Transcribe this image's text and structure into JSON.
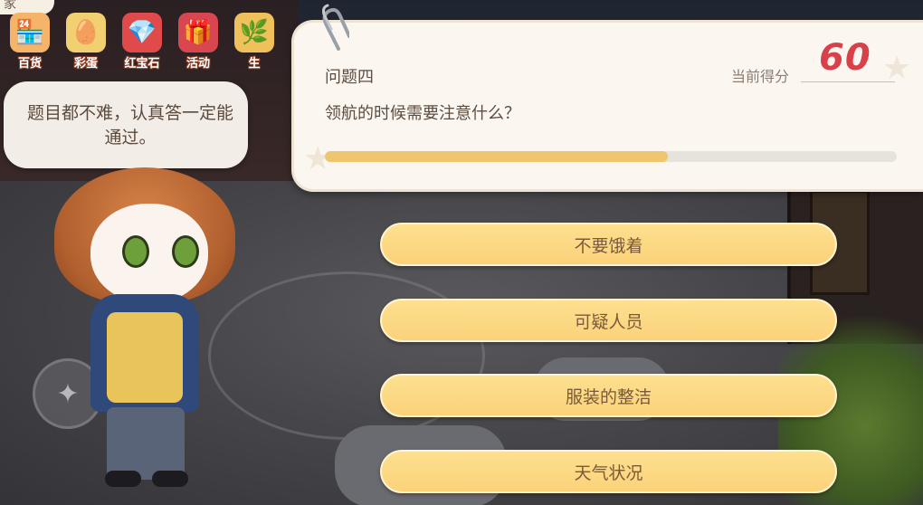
{
  "top_tab": {
    "label": "家"
  },
  "menu": {
    "items": [
      {
        "label": "百货",
        "icon": "shop-icon",
        "color": "#f5b46a"
      },
      {
        "label": "彩蛋",
        "icon": "egg-icon",
        "color": "#f0d071"
      },
      {
        "label": "红宝石",
        "icon": "gem-icon",
        "color": "#e04a4a"
      },
      {
        "label": "活动",
        "icon": "gift-icon",
        "color": "#d8474f"
      },
      {
        "label": "生",
        "icon": "leaf-icon",
        "color": "#f0c05a"
      }
    ]
  },
  "npc": {
    "dialog": "题目都不难，认真答一定能通过。"
  },
  "quiz": {
    "question_title": "问题四",
    "question_text": "领航的时候需要注意什么？",
    "score_label": "当前得分",
    "score_value": "60",
    "progress": 0.6,
    "answers": [
      "不要饿着",
      "可疑人员",
      "服装的整洁",
      "天气状况"
    ]
  },
  "colors": {
    "accent": "#d9414a",
    "answer_bg": "#fbd27a",
    "progress_fill": "#efc56d"
  }
}
